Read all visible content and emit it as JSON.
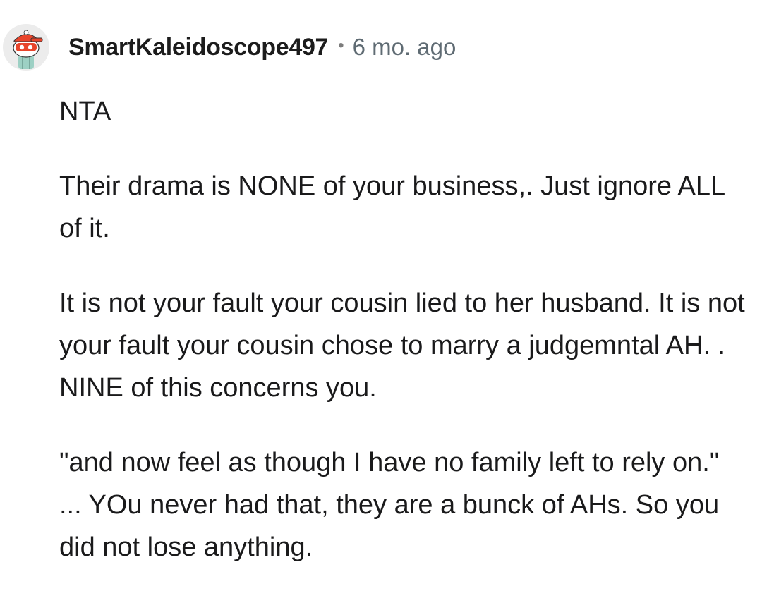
{
  "comment": {
    "author": "SmartKaleidoscope497",
    "separator": "•",
    "timestamp": "6 mo. ago",
    "avatar_icon": "reddit-snoo-avatar-icon",
    "paragraphs": [
      "NTA",
      "Their drama is NONE of your business,. Just ignore ALL of it.",
      "It is not your fault your cousin lied to her husband. It is not your fault your cousin chose to marry a judgemntal AH. . NINE of this concerns you.",
      "\"and now feel as though I have no family left to rely on.\" ... YOu never had that, they are a bunck of AHs. So you did not lose anything."
    ]
  },
  "colors": {
    "background": "#ffffff",
    "text": "#1a1a1b",
    "meta": "#5f6b73",
    "avatar_hat": "#e8452c"
  }
}
